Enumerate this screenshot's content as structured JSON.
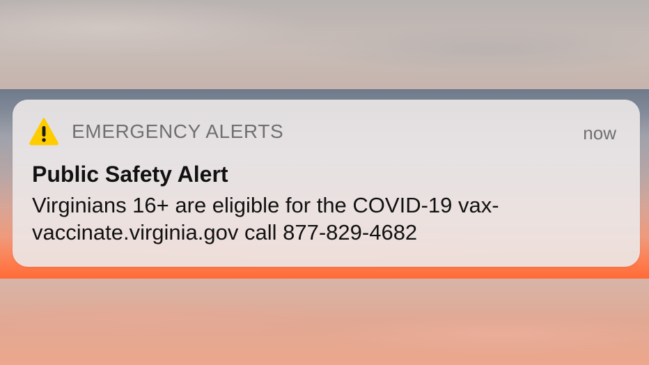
{
  "notification": {
    "app_name": "EMERGENCY ALERTS",
    "time": "now",
    "title": "Public Safety Alert",
    "message_lines": [
      "Virginians 16+ are eligible for the COVID-19 vax-",
      "vaccinate.virginia.gov call 877-829-4682"
    ],
    "icon": "warning-triangle-icon",
    "icon_color": "#FFCC00",
    "icon_mark_color": "#1A1A1A"
  },
  "colors": {
    "card_background": "#ECE8E8",
    "secondary_text": "#707070",
    "primary_text": "#111111"
  }
}
